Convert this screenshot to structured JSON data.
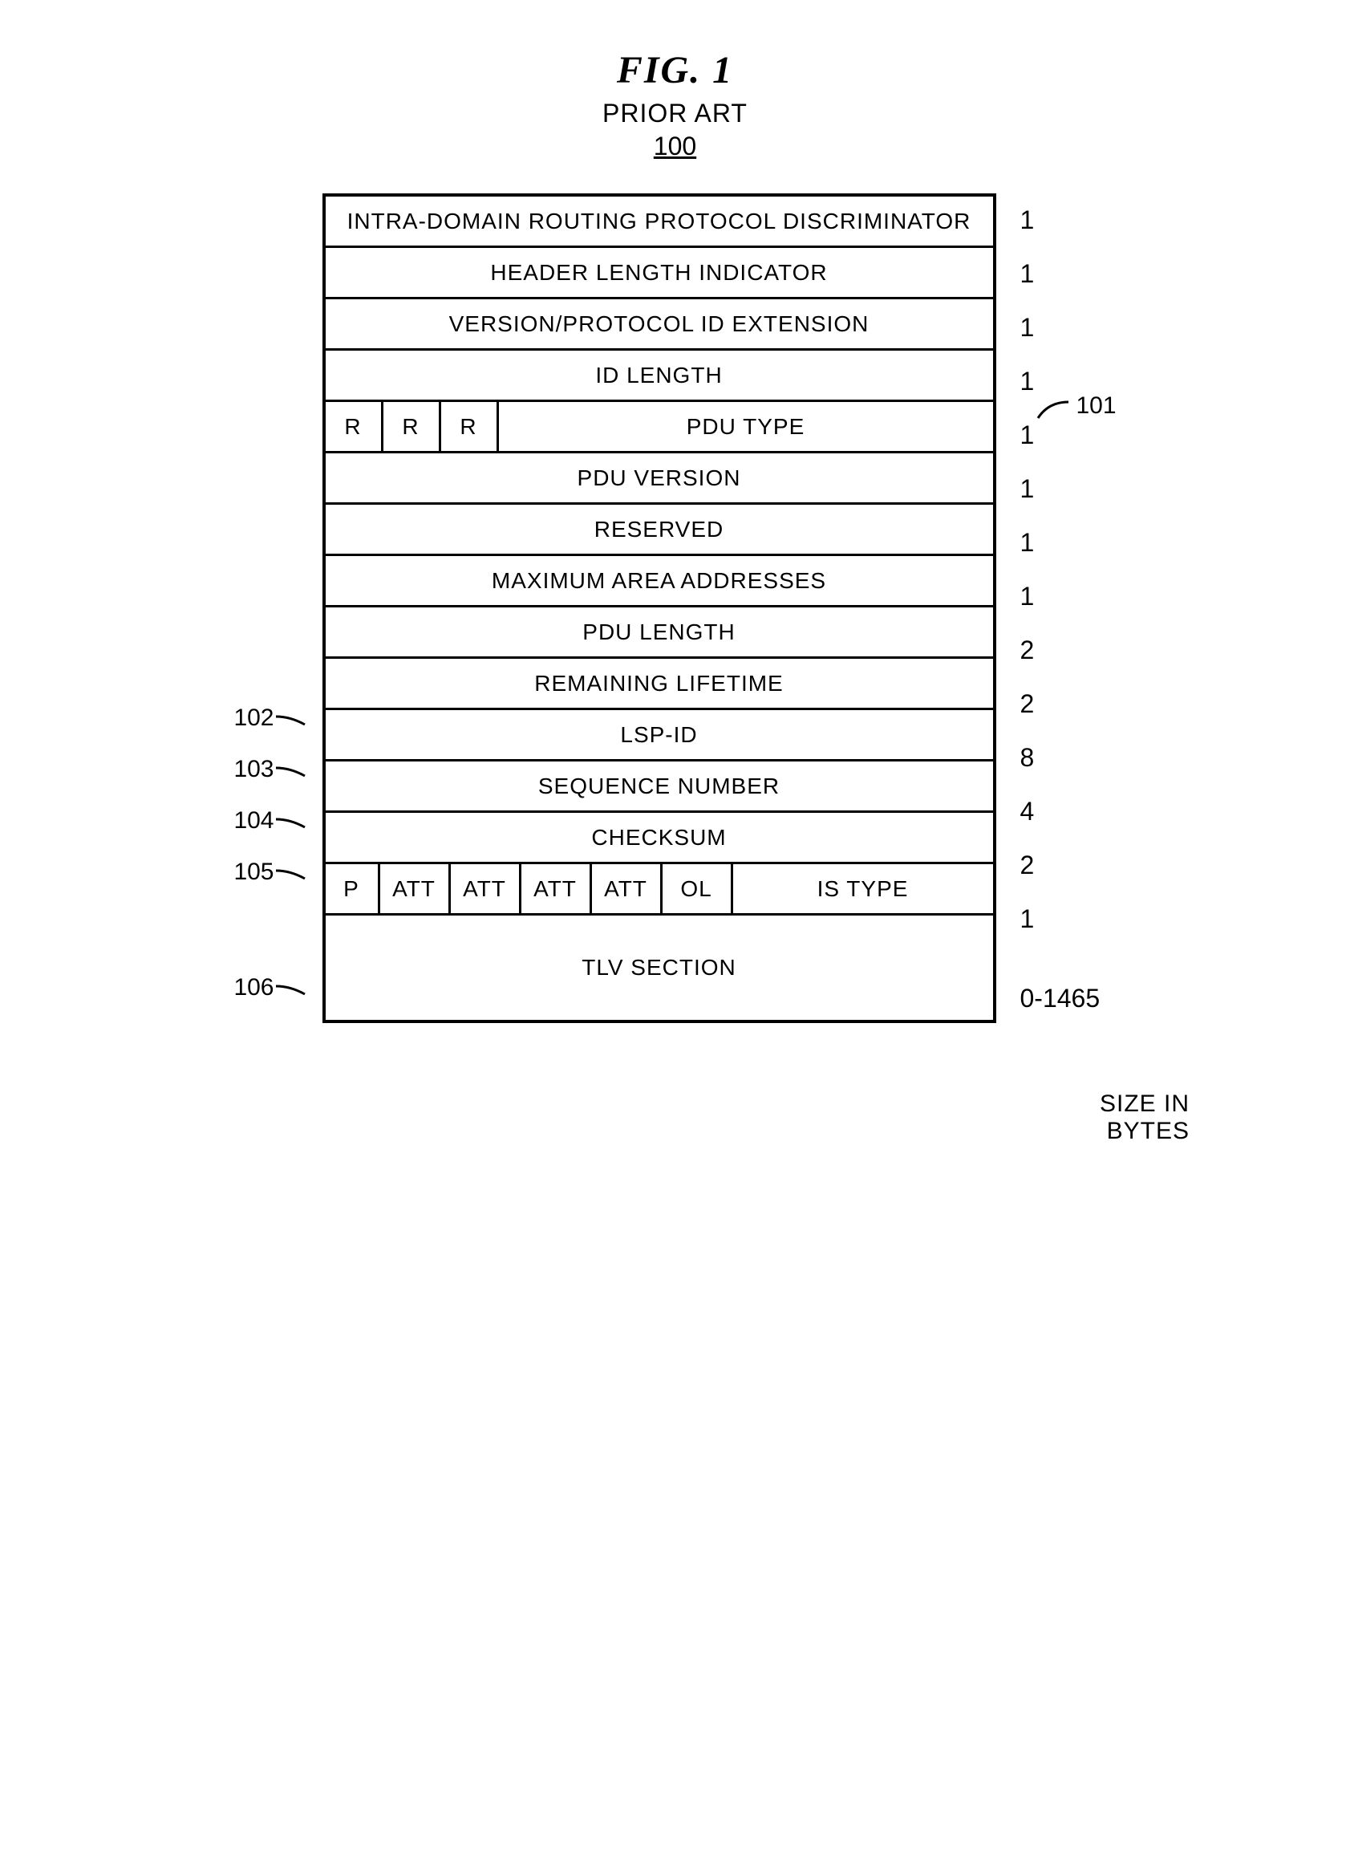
{
  "figure": {
    "label": "FIG.  1",
    "prior_art": "PRIOR ART",
    "number": "100"
  },
  "rows": [
    {
      "name": "INTRA-DOMAIN ROUTING PROTOCOL DISCRIMINATOR",
      "bytes": "1"
    },
    {
      "name": "HEADER LENGTH INDICATOR",
      "bytes": "1"
    },
    {
      "name": "VERSION/PROTOCOL ID EXTENSION",
      "bytes": "1"
    },
    {
      "name": "ID LENGTH",
      "bytes": "1"
    },
    {
      "name": "PDU TYPE",
      "bytes": "1",
      "segments": [
        "R",
        "R",
        "R"
      ],
      "callout": "101"
    },
    {
      "name": "PDU VERSION",
      "bytes": "1"
    },
    {
      "name": "RESERVED",
      "bytes": "1"
    },
    {
      "name": "MAXIMUM AREA ADDRESSES",
      "bytes": "1"
    },
    {
      "name": "PDU LENGTH",
      "bytes": "2"
    },
    {
      "name": "REMAINING LIFETIME",
      "bytes": "2",
      "left_label": "102"
    },
    {
      "name": "LSP-ID",
      "bytes": "8",
      "left_label": "103"
    },
    {
      "name": "SEQUENCE NUMBER",
      "bytes": "4",
      "left_label": "104"
    },
    {
      "name": "CHECKSUM",
      "bytes": "2",
      "left_label": "105"
    },
    {
      "name": "IS TYPE",
      "bytes": "1",
      "flags": [
        "P",
        "ATT",
        "ATT",
        "ATT",
        "ATT",
        "OL"
      ]
    },
    {
      "name": "TLV SECTION",
      "bytes": "0-1465",
      "left_label": "106",
      "tall": true
    }
  ],
  "footer": {
    "line1": "SIZE IN",
    "line2": "BYTES"
  },
  "segments_r": {
    "r0": "R",
    "r1": "R",
    "r2": "R",
    "pdu": "PDU TYPE"
  },
  "flags_row": {
    "p": "P",
    "a0": "ATT",
    "a1": "ATT",
    "a2": "ATT",
    "a3": "ATT",
    "ol": "OL",
    "is": "IS TYPE"
  },
  "callout_101": "101"
}
